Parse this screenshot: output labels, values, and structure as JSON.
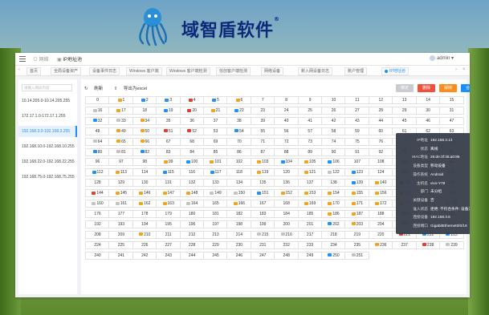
{
  "brand": {
    "name": "域智盾软件",
    "reg": "®"
  },
  "topbar": {
    "crumbs": [
      "网络",
      "IP地址池"
    ],
    "user": "admin"
  },
  "tabs": [
    {
      "label": "首页",
      "active": false
    },
    {
      "label": "全局设备资产",
      "active": false
    },
    {
      "label": "设备事件日志",
      "active": false
    },
    {
      "label": "Windows 客户端",
      "active": false
    },
    {
      "label": "Windows 客户端检测",
      "active": false
    },
    {
      "label": "信创客户端检测",
      "active": false
    },
    {
      "label": "网络设备",
      "active": false
    },
    {
      "label": "新入网设备日志",
      "active": false
    },
    {
      "label": "账户管理",
      "active": false
    },
    {
      "label": "IP地址池",
      "active": true
    }
  ],
  "sidebar": {
    "search_placeholder": "请输入网段内容",
    "segments": [
      {
        "label": "10.14.205.0-10.14.205.255",
        "active": false
      },
      {
        "label": "172.17.1.0-172.17.1.255",
        "active": false
      },
      {
        "label": "192.168.3.0-192.168.3.255",
        "active": true
      },
      {
        "label": "192.168.10.0-192.168.10.255",
        "active": false
      },
      {
        "label": "192.168.22.0-192.168.22.255",
        "active": false
      },
      {
        "label": "192.168.75.0-192.168.75.255",
        "active": false
      }
    ]
  },
  "toolbar": {
    "refresh": "刷新",
    "export": "导出为excel",
    "buttons": [
      {
        "label": "绑定",
        "style": "gray"
      },
      {
        "label": "删除",
        "style": "red"
      },
      {
        "label": "解绑",
        "style": "orange"
      },
      {
        "label": "合并",
        "style": "blue"
      }
    ]
  },
  "colors": {
    "blue": "#1e90ff",
    "orange": "#f7a21b",
    "red": "#ea3b2c",
    "gray": "#c4c4c4",
    "dark": "#555555"
  },
  "ip_cells": {
    "start": 0,
    "end": 251,
    "icons": {
      "1": "orange",
      "2": "blue",
      "3": "blue",
      "4": "red",
      "5": "blue",
      "6": "orange",
      "16": "gray",
      "17": "orange",
      "19": "blue",
      "20": "red",
      "21": "orange",
      "22": "blue",
      "32": "blue",
      "33": "gray",
      "34": "orange",
      "49": "orange",
      "50": "orange",
      "51": "red",
      "52": "red",
      "54": "blue",
      "64": "gray",
      "65": "orange",
      "66": "orange",
      "80": "blue",
      "81": "gray",
      "82": "blue",
      "99": "orange",
      "100": "blue",
      "101": "orange",
      "103": "orange",
      "104": "blue",
      "105": "orange",
      "106": "blue",
      "112": "blue",
      "113": "orange",
      "115": "blue",
      "117": "blue",
      "119": "orange",
      "121": "orange",
      "122": "gray",
      "123": "blue",
      "139": "blue",
      "140": "orange",
      "141": "blue",
      "142": "orange",
      "144": "red",
      "145": "orange",
      "146": "orange",
      "147": "orange",
      "148": "orange",
      "149": "gray",
      "150": "gray",
      "151": "blue",
      "152": "orange",
      "153": "orange",
      "154": "orange",
      "155": "orange",
      "156": "orange",
      "157": "orange",
      "158": "orange",
      "160": "gray",
      "161": "gray",
      "162": "orange",
      "163": "orange",
      "164": "gray",
      "166": "orange",
      "169": "orange",
      "170": "orange",
      "171": "orange",
      "172": "orange",
      "173": "orange",
      "174": "orange",
      "175": "orange",
      "186": "orange",
      "187": "orange",
      "202": "blue",
      "203": "orange",
      "210": "orange",
      "215": "gray",
      "216": "gray",
      "221": "red",
      "222": "blue",
      "223": "blue",
      "236": "orange",
      "238": "red",
      "250": "blue",
      "251": "gray",
      "239": "gray"
    }
  },
  "tooltip": {
    "rows": [
      {
        "k": "IP地址",
        "v": "192.168.3.13"
      },
      {
        "k": "状态",
        "v": "离线"
      },
      {
        "k": "MAC地址",
        "v": "26:de:3f:36:a0:85"
      },
      {
        "k": "设备类型",
        "v": "移动设备"
      },
      {
        "k": "操作系统",
        "v": "Android"
      },
      {
        "k": "主机名",
        "v": "vivo-Y78"
      },
      {
        "k": "部门",
        "v": "未分组"
      },
      {
        "k": "关键设备",
        "v": "否"
      },
      {
        "k": "准入状态",
        "v": "拒绝: 不符合条件: 设备注册并审批通过(设备准注册)"
      },
      {
        "k": "连接设备",
        "v": "192.168.3.6"
      },
      {
        "k": "连接端口",
        "v": "GigabitEthernet0/0/19"
      }
    ]
  }
}
